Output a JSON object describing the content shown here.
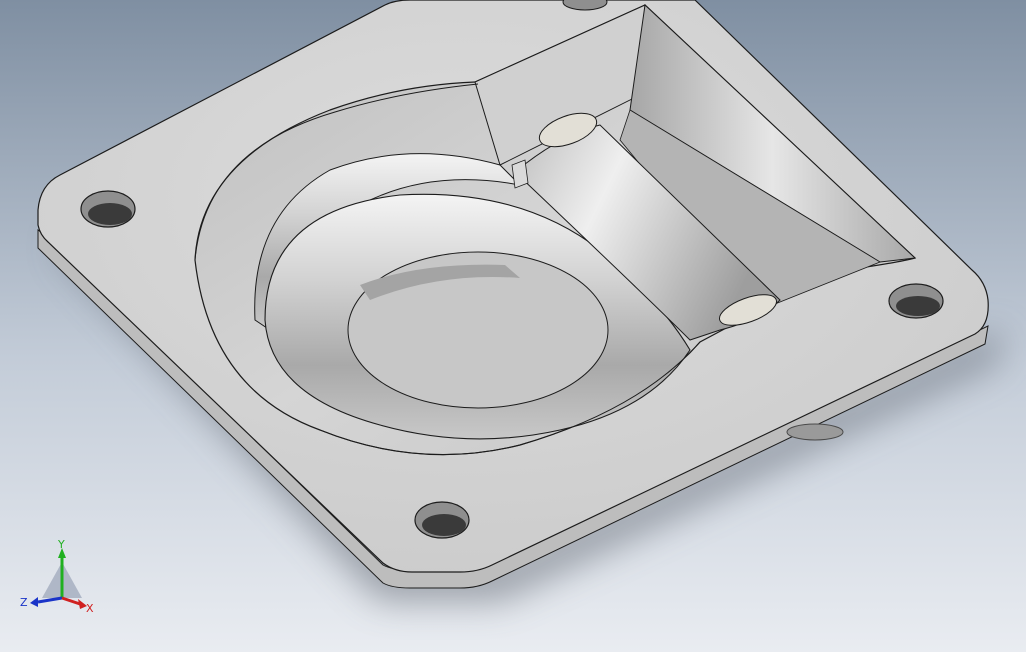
{
  "viewport": {
    "background": {
      "top": "#7f8fa2",
      "mid": "#c3ccd8",
      "bottom": "#e9ecf1"
    }
  },
  "model": {
    "name": "recessed-d-ring-tie-down",
    "body_color": "#d3d3d3",
    "edge_color": "#1c1c1c",
    "bolt_hole_count": 4
  },
  "triad": {
    "x": {
      "label": "X",
      "color": "#d02020"
    },
    "y": {
      "label": "Y",
      "color": "#20b020"
    },
    "z": {
      "label": "Z",
      "color": "#1a34c8"
    }
  }
}
